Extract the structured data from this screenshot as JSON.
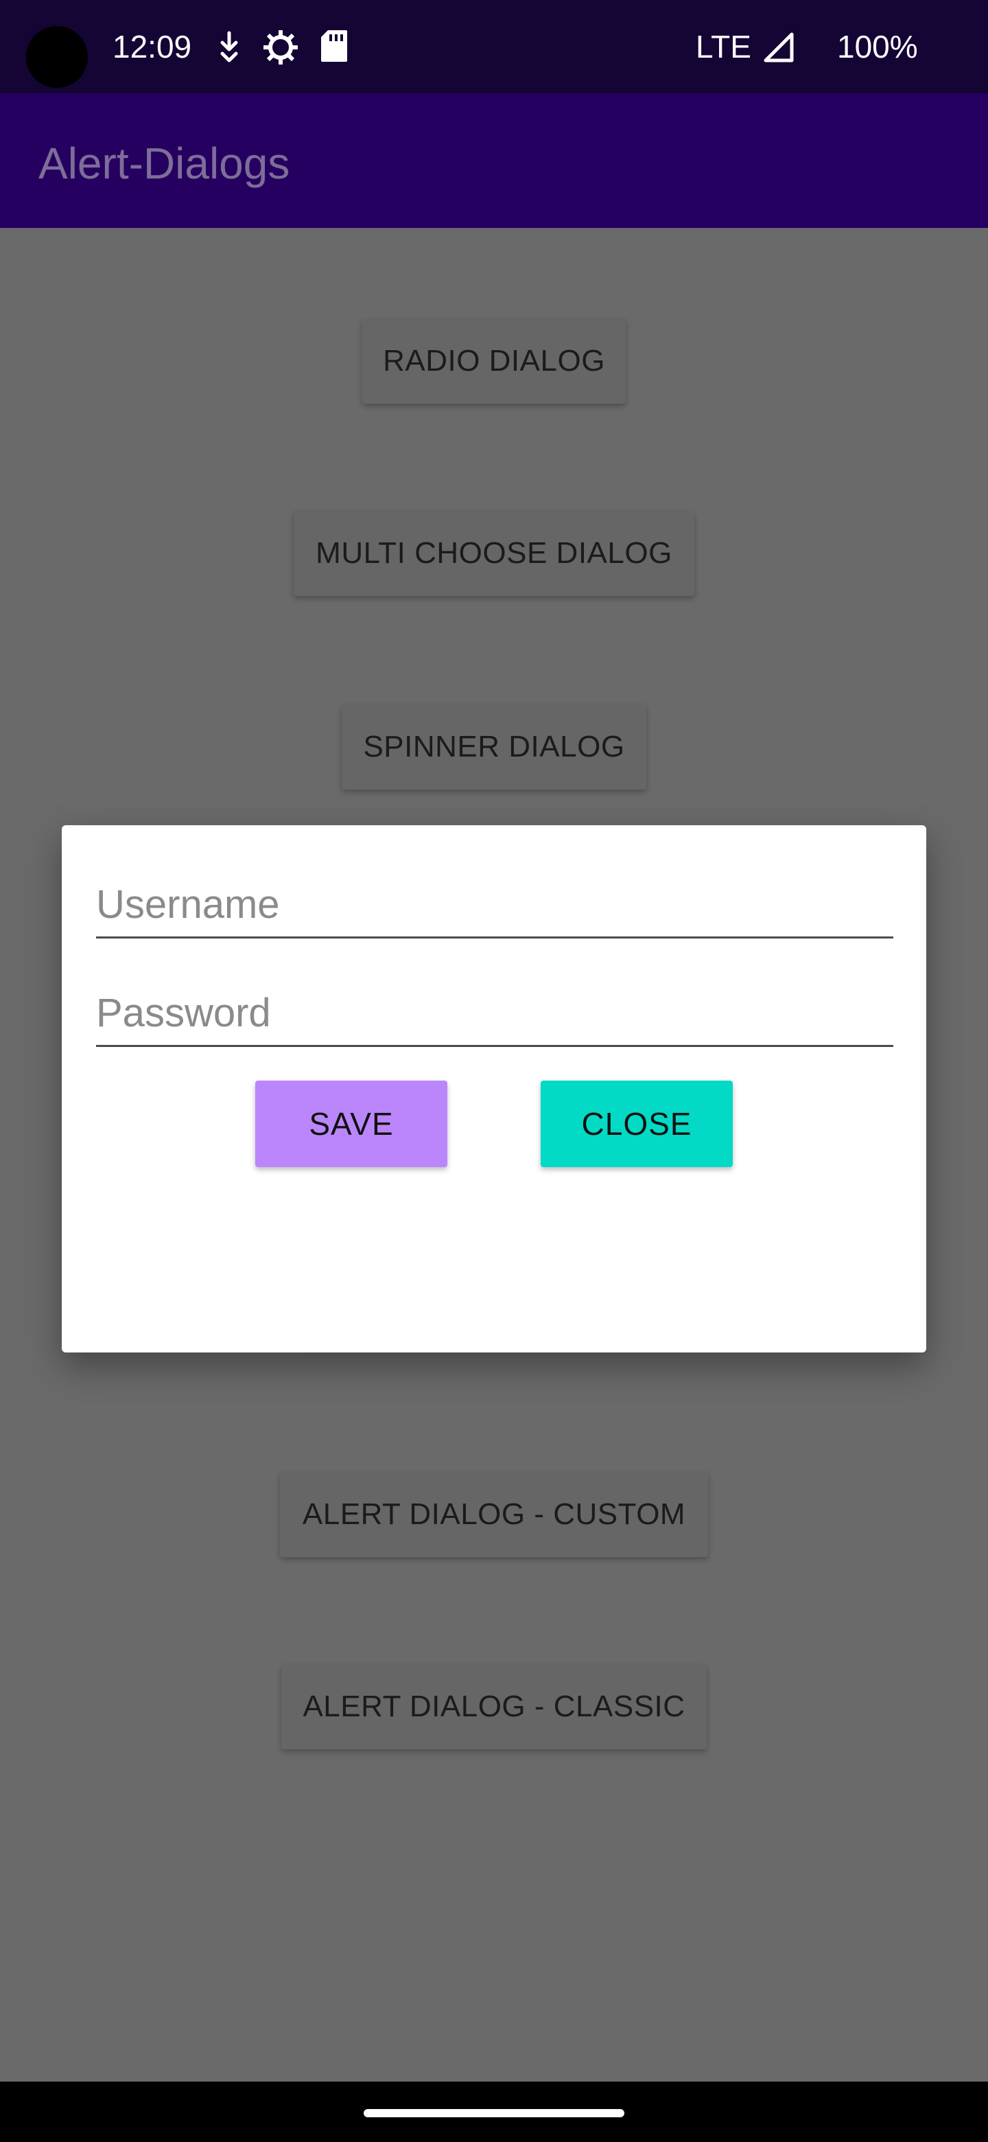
{
  "status_bar": {
    "time": "12:09",
    "network": "LTE",
    "battery": "100%",
    "icons": [
      "camera-cutout",
      "download-icon",
      "settings-gear-icon",
      "sd-card-icon",
      "signal-icon"
    ]
  },
  "app_bar": {
    "title": "Alert-Dialogs",
    "background": "#260061",
    "title_color": "#7d6e98"
  },
  "main": {
    "buttons": [
      {
        "label": "RADIO DIALOG"
      },
      {
        "label": "MULTI CHOOSE DIALOG"
      },
      {
        "label": "SPINNER DIALOG"
      },
      {
        "label": ""
      },
      {
        "label": "ALERT DIALOG - CUSTOM"
      },
      {
        "label": "ALERT DIALOG - CLASSIC"
      }
    ]
  },
  "dialog": {
    "username": {
      "placeholder": "Username",
      "value": ""
    },
    "password": {
      "placeholder": "Password",
      "value": ""
    },
    "save_label": "SAVE",
    "close_label": "CLOSE",
    "save_color": "#bb86fc",
    "close_color": "#03dac5"
  }
}
